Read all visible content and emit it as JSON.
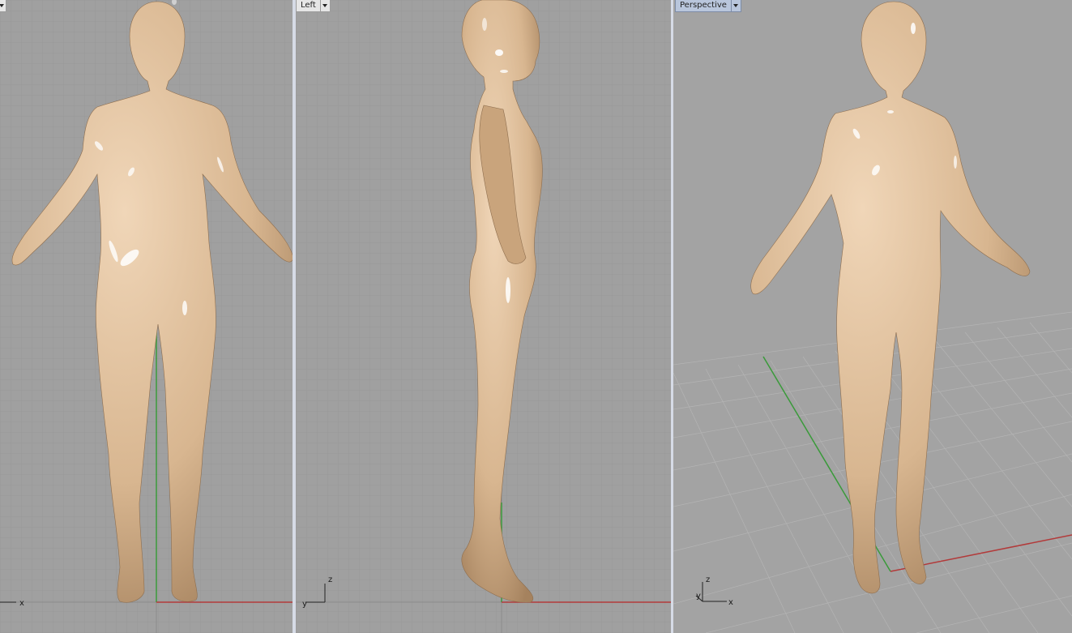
{
  "viewports": {
    "front": {
      "label": ""
    },
    "left": {
      "label": "Left"
    },
    "perspective": {
      "label": "Perspective"
    }
  },
  "axes": {
    "x": "x",
    "y": "y",
    "z": "z"
  },
  "colors": {
    "background": "#a0a0a0",
    "grid_minor": "#999999",
    "grid_major": "#8c8c8c",
    "x_axis": "#b23a3a",
    "y_axis": "#3a9a3a",
    "skin": "#dcbb98",
    "active_tab": "#b9c6dc"
  }
}
